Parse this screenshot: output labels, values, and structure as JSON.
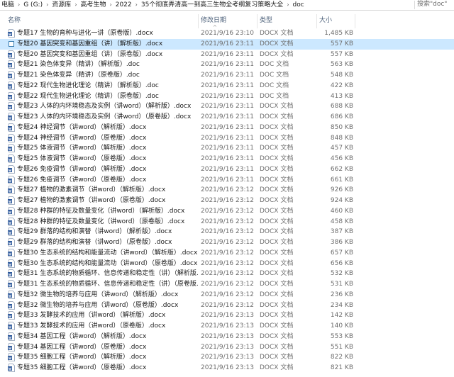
{
  "address_bar": {
    "breadcrumbs": [
      "电脑",
      "G (G:)",
      "资源库",
      "高考生物",
      "2022",
      "35个彻底弄清高一到高三生物全考纲复习策略大全",
      "doc"
    ],
    "search_placeholder": "搜索\"doc\""
  },
  "columns": {
    "name": "名称",
    "date": "修改日期",
    "type": "类型",
    "size": "大小"
  },
  "files": [
    {
      "name": "专题17 生物的育种与进化一讲（原卷版）.docx",
      "date": "2021/9/16 23:10",
      "type": "DOCX 文档",
      "size": "1,485 KB",
      "icon": "docx-icon",
      "selected": false
    },
    {
      "name": "专题20 基因突变和基因重组（讲）（解析版）.docx",
      "date": "2021/9/16 23:11",
      "type": "DOCX 文档",
      "size": "557 KB",
      "icon": "docx-icon",
      "selected": true
    },
    {
      "name": "专题20 基因突变和基因重组（讲）（原卷版）.docx",
      "date": "2021/9/16 23:11",
      "type": "DOCX 文档",
      "size": "557 KB",
      "icon": "docx-icon",
      "selected": false
    },
    {
      "name": "专题21 染色体变异（精讲）（解析版）.doc",
      "date": "2021/9/16 23:11",
      "type": "DOC 文档",
      "size": "563 KB",
      "icon": "doc-icon",
      "selected": false
    },
    {
      "name": "专题21 染色体变异（精讲）（原卷版）.doc",
      "date": "2021/9/16 23:11",
      "type": "DOC 文档",
      "size": "548 KB",
      "icon": "doc-icon",
      "selected": false
    },
    {
      "name": "专题22 现代生物进化理论（精讲）（解析版）.doc",
      "date": "2021/9/16 23:11",
      "type": "DOC 文档",
      "size": "422 KB",
      "icon": "doc-icon",
      "selected": false
    },
    {
      "name": "专题22 现代生物进化理论（精讲）（原卷版）.doc",
      "date": "2021/9/16 23:11",
      "type": "DOC 文档",
      "size": "413 KB",
      "icon": "doc-icon",
      "selected": false
    },
    {
      "name": "专题23 人体的内环境稳态及实例（讲word）（解析版）.docx",
      "date": "2021/9/16 23:11",
      "type": "DOCX 文档",
      "size": "688 KB",
      "icon": "docx-icon",
      "selected": false
    },
    {
      "name": "专题23 人体的内环境稳态及实例（讲word）（原卷版）.docx",
      "date": "2021/9/16 23:11",
      "type": "DOCX 文档",
      "size": "686 KB",
      "icon": "docx-icon",
      "selected": false
    },
    {
      "name": "专题24 神经调节（讲word）（解析版）.docx",
      "date": "2021/9/16 23:11",
      "type": "DOCX 文档",
      "size": "850 KB",
      "icon": "docx-icon",
      "selected": false
    },
    {
      "name": "专题24 神经调节（讲word）（原卷版）.docx",
      "date": "2021/9/16 23:11",
      "type": "DOCX 文档",
      "size": "848 KB",
      "icon": "docx-icon",
      "selected": false
    },
    {
      "name": "专题25 体液调节（讲word）（解析版）.docx",
      "date": "2021/9/16 23:11",
      "type": "DOCX 文档",
      "size": "457 KB",
      "icon": "docx-icon",
      "selected": false
    },
    {
      "name": "专题25 体液调节（讲word）（原卷版）.docx",
      "date": "2021/9/16 23:11",
      "type": "DOCX 文档",
      "size": "456 KB",
      "icon": "docx-icon",
      "selected": false
    },
    {
      "name": "专题26 免疫调节（讲word）（解析版）.docx",
      "date": "2021/9/16 23:11",
      "type": "DOCX 文档",
      "size": "662 KB",
      "icon": "docx-icon",
      "selected": false
    },
    {
      "name": "专题26 免疫调节（讲word）（原卷版）.docx",
      "date": "2021/9/16 23:11",
      "type": "DOCX 文档",
      "size": "661 KB",
      "icon": "docx-icon",
      "selected": false
    },
    {
      "name": "专题27 植物的激素调节（讲word）（解析版）.docx",
      "date": "2021/9/16 23:12",
      "type": "DOCX 文档",
      "size": "926 KB",
      "icon": "docx-icon",
      "selected": false
    },
    {
      "name": "专题27 植物的激素调节（讲word）（原卷版）.docx",
      "date": "2021/9/16 23:12",
      "type": "DOCX 文档",
      "size": "924 KB",
      "icon": "docx-icon",
      "selected": false
    },
    {
      "name": "专题28 种群的特征及数量变化（讲word）（解析版）.docx",
      "date": "2021/9/16 23:12",
      "type": "DOCX 文档",
      "size": "460 KB",
      "icon": "docx-icon",
      "selected": false
    },
    {
      "name": "专题28 种群的特征及数量变化（讲word）（原卷版）.docx",
      "date": "2021/9/16 23:12",
      "type": "DOCX 文档",
      "size": "458 KB",
      "icon": "docx-icon",
      "selected": false
    },
    {
      "name": "专题29 群落的结构和演替（讲word）（解析版）.docx",
      "date": "2021/9/16 23:12",
      "type": "DOCX 文档",
      "size": "387 KB",
      "icon": "docx-icon",
      "selected": false
    },
    {
      "name": "专题29 群落的结构和演替（讲word）（原卷版）.docx",
      "date": "2021/9/16 23:12",
      "type": "DOCX 文档",
      "size": "386 KB",
      "icon": "docx-icon",
      "selected": false
    },
    {
      "name": "专题30 生态系统的结构和能量流动（讲word）（解析版）.docx",
      "date": "2021/9/16 23:12",
      "type": "DOCX 文档",
      "size": "657 KB",
      "icon": "docx-icon",
      "selected": false
    },
    {
      "name": "专题30 生态系统的结构和能量流动（讲word）（原卷版）.docx",
      "date": "2021/9/16 23:12",
      "type": "DOCX 文档",
      "size": "656 KB",
      "icon": "docx-icon",
      "selected": false
    },
    {
      "name": "专题31 生态系统的物质循环、信息传递和稳定性（讲）（解析版...",
      "date": "2021/9/16 23:12",
      "type": "DOCX 文档",
      "size": "532 KB",
      "icon": "docx-icon",
      "selected": false
    },
    {
      "name": "专题31 生态系统的物质循环、信息传递和稳定性（讲）（原卷版...",
      "date": "2021/9/16 23:12",
      "type": "DOCX 文档",
      "size": "531 KB",
      "icon": "docx-icon",
      "selected": false
    },
    {
      "name": "专题32 微生物的培养与应用（讲word）（解析版）.docx",
      "date": "2021/9/16 23:12",
      "type": "DOCX 文档",
      "size": "236 KB",
      "icon": "docx-icon",
      "selected": false
    },
    {
      "name": "专题32 微生物的培养与应用（讲word）（原卷版）.docx",
      "date": "2021/9/16 23:12",
      "type": "DOCX 文档",
      "size": "234 KB",
      "icon": "docx-icon",
      "selected": false
    },
    {
      "name": "专题33 发酵技术的应用（讲word）（解析版）.docx",
      "date": "2021/9/16 23:13",
      "type": "DOCX 文档",
      "size": "142 KB",
      "icon": "docx-icon",
      "selected": false
    },
    {
      "name": "专题33 发酵技术的应用（讲word）（原卷版）.docx",
      "date": "2021/9/16 23:13",
      "type": "DOCX 文档",
      "size": "140 KB",
      "icon": "docx-icon",
      "selected": false
    },
    {
      "name": "专题34 基因工程（讲word）（解析版）.docx",
      "date": "2021/9/16 23:13",
      "type": "DOCX 文档",
      "size": "553 KB",
      "icon": "docx-icon",
      "selected": false
    },
    {
      "name": "专题34 基因工程（讲word）（原卷版）.docx",
      "date": "2021/9/16 23:13",
      "type": "DOCX 文档",
      "size": "551 KB",
      "icon": "docx-icon",
      "selected": false
    },
    {
      "name": "专题35 细胞工程（讲word）（解析版）.docx",
      "date": "2021/9/16 23:13",
      "type": "DOCX 文档",
      "size": "822 KB",
      "icon": "docx-icon",
      "selected": false
    },
    {
      "name": "专题35 细胞工程（讲word）（原卷版）.docx",
      "date": "2021/9/16 23:13",
      "type": "DOCX 文档",
      "size": "821 KB",
      "icon": "docx-icon",
      "selected": false
    }
  ],
  "colors": {
    "selection": "#cce8ff",
    "header_text": "#4c607a",
    "word_blue": "#2b579a"
  }
}
